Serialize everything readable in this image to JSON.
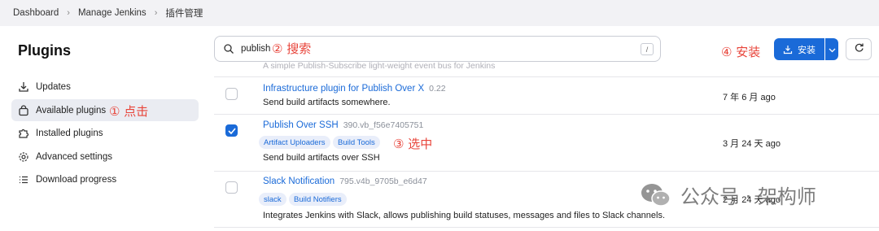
{
  "breadcrumb": [
    "Dashboard",
    "Manage Jenkins",
    "插件管理"
  ],
  "sidebar": {
    "title": "Plugins",
    "items": [
      {
        "label": "Updates",
        "icon": "download-icon",
        "active": false
      },
      {
        "label": "Available plugins",
        "icon": "shopping-bag-icon",
        "active": true
      },
      {
        "label": "Installed plugins",
        "icon": "puzzle-icon",
        "active": false
      },
      {
        "label": "Advanced settings",
        "icon": "gear-icon",
        "active": false
      },
      {
        "label": "Download progress",
        "icon": "list-icon",
        "active": false
      }
    ]
  },
  "search": {
    "value": "publish",
    "shortcut": "/"
  },
  "ghost_row": "A simple Publish-Subscribe light-weight event bus for Jenkins",
  "toolbar": {
    "install_label": "安装"
  },
  "annotations": {
    "click": "① 点击",
    "search": "② 搜索",
    "select": "③ 选中",
    "install": "④ 安装"
  },
  "plugins": [
    {
      "name": "Infrastructure plugin for Publish Over X",
      "version": "0.22",
      "tags": [],
      "description": "Send build artifacts somewhere.",
      "released": "7 年 6 月 ago",
      "checked": false
    },
    {
      "name": "Publish Over SSH",
      "version": "390.vb_f56e7405751",
      "tags": [
        "Artifact Uploaders",
        "Build Tools"
      ],
      "description": "Send build artifacts over SSH",
      "released": "3 月 24 天 ago",
      "checked": true
    },
    {
      "name": "Slack Notification",
      "version": "795.v4b_9705b_e6d47",
      "tags": [
        "slack",
        "Build Notifiers"
      ],
      "description": "Integrates Jenkins with Slack, allows publishing build statuses, messages and files to Slack channels.",
      "released": "2 月 24 天 ago",
      "checked": false
    }
  ],
  "watermark": "公众号 · 架构师",
  "colors": {
    "accent": "#1a6ad8",
    "annotation": "#e8443a"
  }
}
